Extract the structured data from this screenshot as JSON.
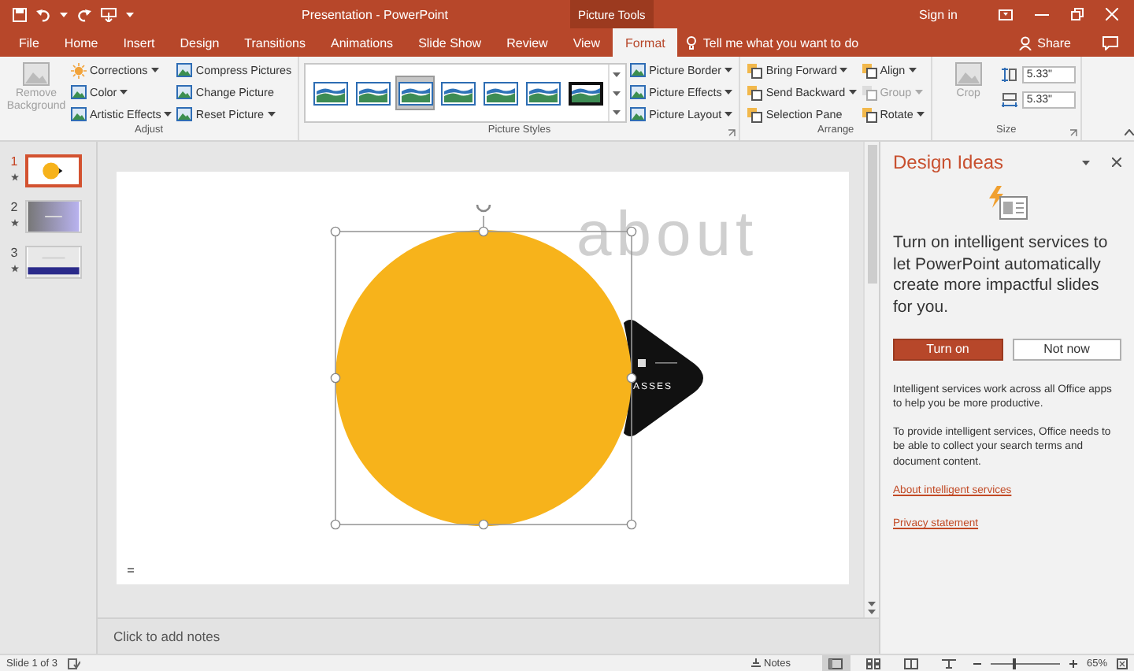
{
  "title_bar": {
    "title": "Presentation - PowerPoint",
    "context_group": "Picture Tools",
    "sign_in": "Sign in"
  },
  "tabs": [
    {
      "label": "File",
      "selected": false,
      "kind": "normal"
    },
    {
      "label": "Home",
      "selected": false,
      "kind": "normal"
    },
    {
      "label": "Insert",
      "selected": false,
      "kind": "normal"
    },
    {
      "label": "Design",
      "selected": false,
      "kind": "normal"
    },
    {
      "label": "Transitions",
      "selected": false,
      "kind": "normal"
    },
    {
      "label": "Animations",
      "selected": false,
      "kind": "normal"
    },
    {
      "label": "Slide Show",
      "selected": false,
      "kind": "normal"
    },
    {
      "label": "Review",
      "selected": false,
      "kind": "normal"
    },
    {
      "label": "View",
      "selected": false,
      "kind": "normal"
    },
    {
      "label": "Format",
      "selected": true,
      "kind": "context"
    }
  ],
  "tell_me": {
    "placeholder": "Tell me what you want to do"
  },
  "share": "Share",
  "ribbon": {
    "groups": [
      {
        "label": "Adjust",
        "launcher": false,
        "large": {
          "label": "Remove Background",
          "disabled": true
        },
        "columns": [
          [
            {
              "label": "Corrections",
              "dropdown": true,
              "disabled": false
            },
            {
              "label": "Color",
              "dropdown": true,
              "disabled": false
            },
            {
              "label": "Artistic Effects",
              "dropdown": true,
              "disabled": false
            }
          ],
          [
            {
              "label": "Compress Pictures",
              "dropdown": false,
              "disabled": false
            },
            {
              "label": "Change Picture",
              "dropdown": false,
              "disabled": false
            },
            {
              "label": "Reset Picture",
              "dropdown": true,
              "disabled": false
            }
          ]
        ]
      },
      {
        "label": "Picture Styles",
        "launcher": true,
        "gallery": [
          {
            "selected": false
          },
          {
            "selected": false
          },
          {
            "selected": true
          },
          {
            "selected": false
          },
          {
            "selected": false
          },
          {
            "selected": false
          },
          {
            "selected": false
          }
        ],
        "columns": [
          [
            {
              "label": "Picture Border",
              "dropdown": true,
              "disabled": false
            },
            {
              "label": "Picture Effects",
              "dropdown": true,
              "disabled": false
            },
            {
              "label": "Picture Layout",
              "dropdown": true,
              "disabled": false
            }
          ]
        ]
      },
      {
        "label": "Arrange",
        "launcher": false,
        "columns": [
          [
            {
              "label": "Bring Forward",
              "dropdown": true,
              "disabled": false
            },
            {
              "label": "Send Backward",
              "dropdown": true,
              "disabled": false
            },
            {
              "label": "Selection Pane",
              "dropdown": false,
              "disabled": false
            }
          ],
          [
            {
              "label": "Align",
              "dropdown": true,
              "disabled": false
            },
            {
              "label": "Group",
              "dropdown": true,
              "disabled": true
            },
            {
              "label": "Rotate",
              "dropdown": true,
              "disabled": false
            }
          ]
        ]
      },
      {
        "label": "Size",
        "launcher": true,
        "large": {
          "label": "Crop",
          "disabled": true
        },
        "fields": [
          {
            "value": "5.33\""
          },
          {
            "value": "5.33\""
          }
        ]
      }
    ]
  },
  "thumbnails": [
    {
      "number": "1",
      "selected": true,
      "animated": true,
      "kind": "circle"
    },
    {
      "number": "2",
      "selected": false,
      "animated": true,
      "kind": "gradient"
    },
    {
      "number": "3",
      "selected": false,
      "animated": true,
      "kind": "banner"
    }
  ],
  "slide": {
    "watermark": "about",
    "badge_text": "ASSES",
    "shape_selected": true
  },
  "notes": {
    "placeholder": "Click to add notes"
  },
  "design_pane": {
    "title": "Design Ideas",
    "message": "Turn on intelligent services to let PowerPoint automatically create more impactful slides for you.",
    "buttons": [
      {
        "label": "Turn on",
        "kind": "primary"
      },
      {
        "label": "Not now",
        "kind": "secondary"
      }
    ],
    "paragraphs": [
      "Intelligent services work across all Office apps to help you be more productive.",
      "To provide intelligent services, Office needs to be able to collect your search terms and document content."
    ],
    "links": [
      "About intelligent services",
      "Privacy statement"
    ]
  },
  "status_bar": {
    "slide_info": "Slide 1 of 3",
    "notes": "Notes",
    "views": [
      {
        "selected": true
      },
      {
        "selected": false
      },
      {
        "selected": false
      },
      {
        "selected": false
      }
    ],
    "zoom": {
      "level": 0.35,
      "reading": "65%"
    }
  }
}
